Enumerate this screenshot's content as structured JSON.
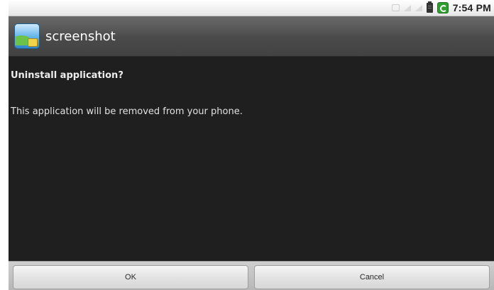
{
  "status_bar": {
    "time": "7:54 PM",
    "icons": [
      "usb-icon",
      "signal-icon",
      "signal-icon",
      "battery-icon",
      "sync-icon"
    ]
  },
  "title_bar": {
    "app_icon": "gallery-app-icon",
    "title": "screenshot"
  },
  "dialog": {
    "title": "Uninstall application?",
    "message": "This application will be removed from your phone.",
    "buttons": {
      "ok": "OK",
      "cancel": "Cancel"
    }
  }
}
